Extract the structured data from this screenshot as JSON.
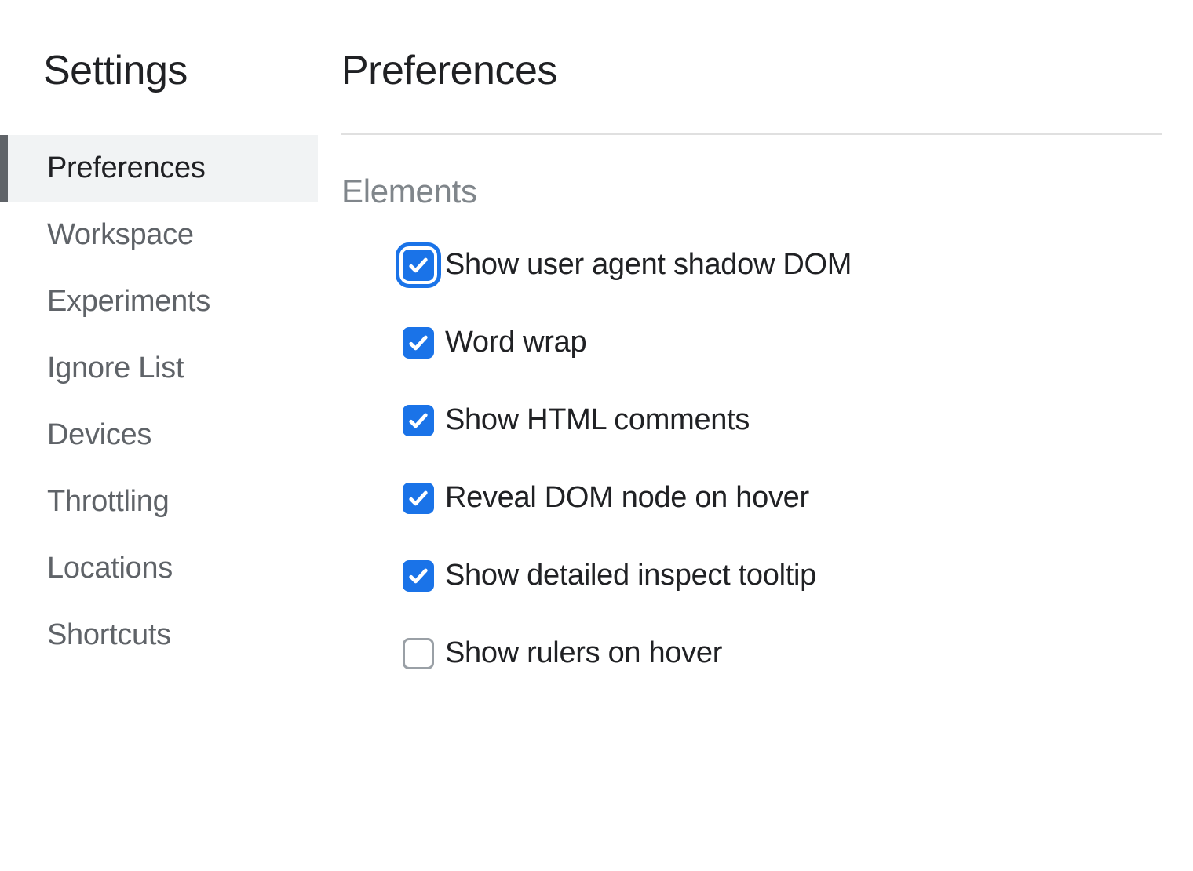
{
  "sidebar": {
    "title": "Settings",
    "items": [
      {
        "label": "Preferences",
        "active": true
      },
      {
        "label": "Workspace",
        "active": false
      },
      {
        "label": "Experiments",
        "active": false
      },
      {
        "label": "Ignore List",
        "active": false
      },
      {
        "label": "Devices",
        "active": false
      },
      {
        "label": "Throttling",
        "active": false
      },
      {
        "label": "Locations",
        "active": false
      },
      {
        "label": "Shortcuts",
        "active": false
      }
    ]
  },
  "main": {
    "title": "Preferences",
    "section": {
      "title": "Elements",
      "options": [
        {
          "label": "Show user agent shadow DOM",
          "checked": true,
          "focused": true
        },
        {
          "label": "Word wrap",
          "checked": true,
          "focused": false
        },
        {
          "label": "Show HTML comments",
          "checked": true,
          "focused": false
        },
        {
          "label": "Reveal DOM node on hover",
          "checked": true,
          "focused": false
        },
        {
          "label": "Show detailed inspect tooltip",
          "checked": true,
          "focused": false
        },
        {
          "label": "Show rulers on hover",
          "checked": false,
          "focused": false
        }
      ]
    }
  }
}
